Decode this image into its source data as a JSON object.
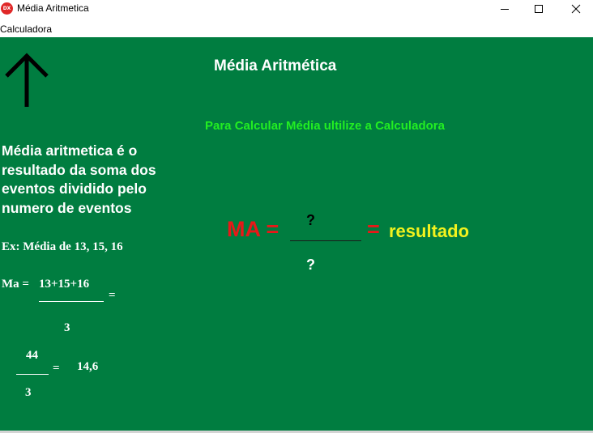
{
  "window": {
    "title": "Média Aritmetica",
    "icon": "dx-app-icon",
    "icon_text": "DX"
  },
  "menu": {
    "items": [
      {
        "label": "Calculadora"
      }
    ]
  },
  "content": {
    "heading": "Média Aritmética",
    "hint": "Para Calcular Média ultilize a Calculadora",
    "definition": "Média aritmetica é o resultado da soma dos eventos dividido pelo numero de eventos",
    "example_intro": "Ex: Média de 13, 15, 16",
    "example_ma_label": "Ma =",
    "example_numerator": "13+15+16",
    "example_eq1": "=",
    "example_denominator": "3",
    "example_sum": "44",
    "example_eq2": "=",
    "example_result": "14,6",
    "example_sum_denominator": "3",
    "formula_ma": "MA =",
    "formula_numerator": "?",
    "formula_denominator": "?",
    "formula_eq": "=",
    "formula_result": "resultado"
  },
  "colors": {
    "background": "#007d40",
    "text_primary": "#ffffff",
    "hint": "#22ee22",
    "formula_ma": "#e81818",
    "formula_result": "#f2f21e"
  }
}
